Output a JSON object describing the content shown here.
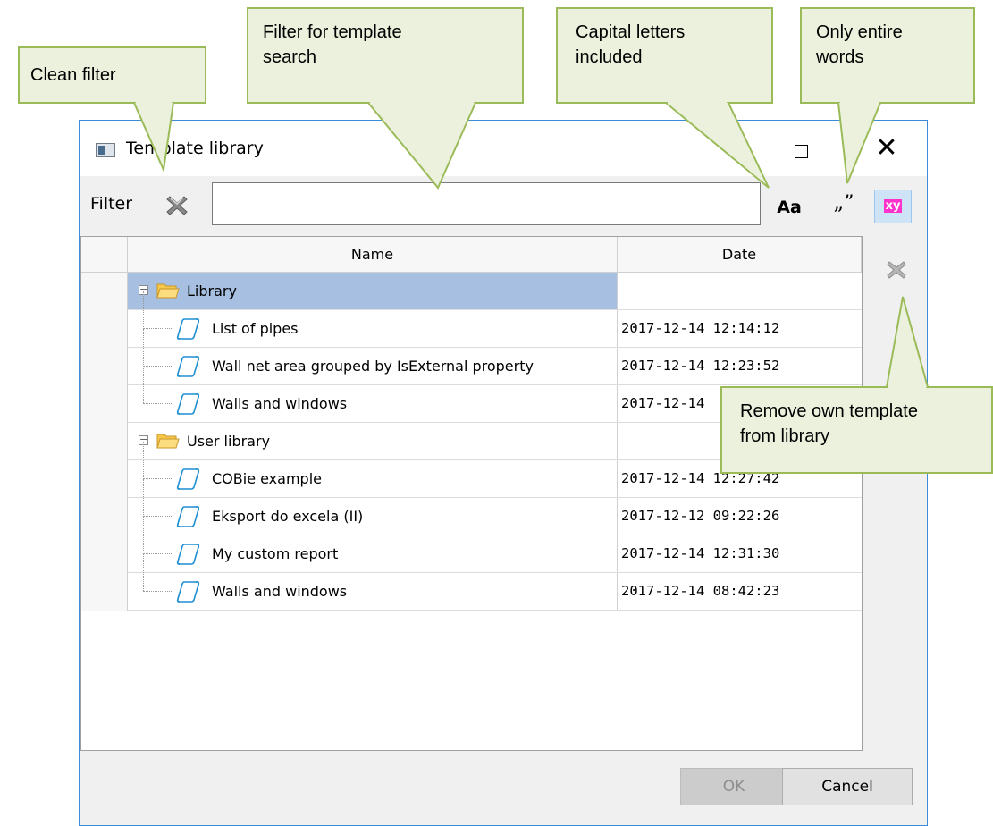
{
  "callouts": {
    "clean_filter": "Clean filter",
    "filter_search_line1": "Filter for template",
    "filter_search_line2": "search",
    "capital_line1": "Capital letters",
    "capital_line2": "included",
    "entire_line1": "Only entire",
    "entire_line2": "words",
    "remove_line1": "Remove own template",
    "remove_line2": "from library"
  },
  "window": {
    "title": "Template library",
    "close_glyph": "✕"
  },
  "filter": {
    "label": "Filter",
    "value": "",
    "case_label": "Aa",
    "words_label": "„”",
    "regex_label": "xy"
  },
  "grid": {
    "columns": [
      "Name",
      "Date"
    ],
    "groups": [
      {
        "name": "Library",
        "selected": true,
        "items": [
          {
            "name": "List of pipes",
            "date": "2017-12-14 12:14:12"
          },
          {
            "name": "Wall net area grouped by IsExternal property",
            "date": "2017-12-14 12:23:52"
          },
          {
            "name": "Walls and windows",
            "date": "2017-12-14"
          }
        ]
      },
      {
        "name": "User library",
        "selected": false,
        "items": [
          {
            "name": "COBie example",
            "date": "2017-12-14 12:27:42"
          },
          {
            "name": "Eksport do excela (II)",
            "date": "2017-12-12 09:22:26"
          },
          {
            "name": "My custom report",
            "date": "2017-12-14 12:31:30"
          },
          {
            "name": "Walls and windows",
            "date": "2017-12-14 08:42:23"
          }
        ]
      }
    ]
  },
  "buttons": {
    "ok": "OK",
    "cancel": "Cancel"
  },
  "colors": {
    "callout_fill": "#ebf1dd",
    "callout_border": "#9bbb59",
    "selection": "#a7bfe0",
    "window_border": "#3c8bd6"
  },
  "icons": [
    "app-icon",
    "clear-filter-icon",
    "folder-icon",
    "template-icon",
    "remove-icon"
  ]
}
